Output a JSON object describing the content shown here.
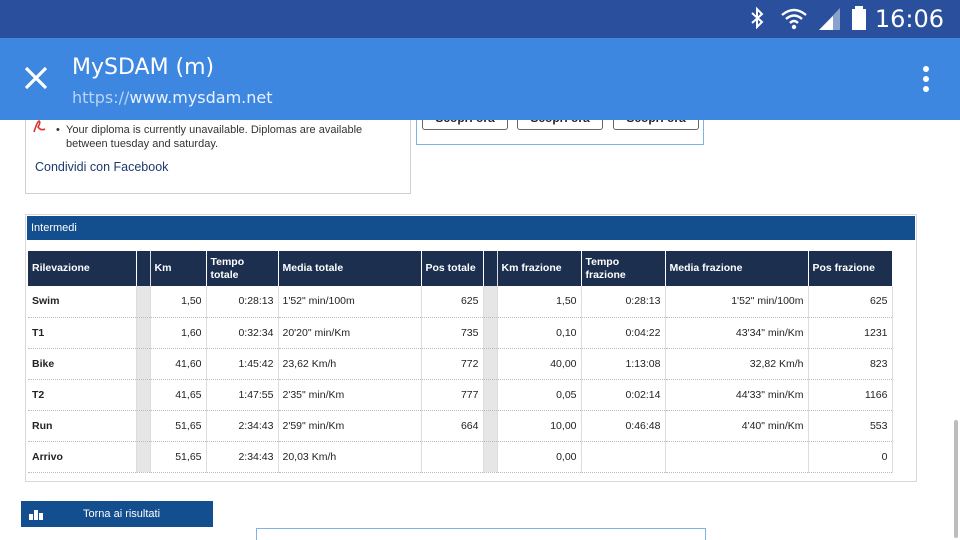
{
  "status_bar": {
    "time": "16:06"
  },
  "app_bar": {
    "title": "MySDAM (m)",
    "url_protocol": "https://",
    "url_host": "www.mysdam.net"
  },
  "diploma": {
    "message": "Your diploma is currently unavailable. Diplomas are available between tuesday and saturday."
  },
  "share": {
    "facebook_label": "Condividi con Facebook"
  },
  "promo": {
    "buttons": [
      "Scopri ora",
      "Scopri ora",
      "Scopri ora"
    ]
  },
  "intermedi": {
    "title": "Intermedi",
    "headers": {
      "rilevazione": "Rilevazione",
      "km": "Km",
      "tempo_totale": "Tempo totale",
      "media_totale": "Media totale",
      "pos_totale": "Pos totale",
      "km_frazione": "Km frazione",
      "tempo_frazione": "Tempo frazione",
      "media_frazione": "Media frazione",
      "pos_frazione": "Pos frazione"
    },
    "rows": [
      {
        "name": "Swim",
        "km": "1,50",
        "tempo": "0:28:13",
        "media": "1'52\" min/100m",
        "pos": "625",
        "kmf": "1,50",
        "tempof": "0:28:13",
        "mediaf": "1'52\" min/100m",
        "posf": "625"
      },
      {
        "name": "T1",
        "km": "1,60",
        "tempo": "0:32:34",
        "media": "20'20\" min/Km",
        "pos": "735",
        "kmf": "0,10",
        "tempof": "0:04:22",
        "mediaf": "43'34\" min/Km",
        "posf": "1231"
      },
      {
        "name": "Bike",
        "km": "41,60",
        "tempo": "1:45:42",
        "media": "23,62 Km/h",
        "pos": "772",
        "kmf": "40,00",
        "tempof": "1:13:08",
        "mediaf": "32,82 Km/h",
        "posf": "823"
      },
      {
        "name": "T2",
        "km": "41,65",
        "tempo": "1:47:55",
        "media": "2'35\" min/Km",
        "pos": "777",
        "kmf": "0,05",
        "tempof": "0:02:14",
        "mediaf": "44'33\" min/Km",
        "posf": "1166"
      },
      {
        "name": "Run",
        "km": "51,65",
        "tempo": "2:34:43",
        "media": "2'59\" min/Km",
        "pos": "664",
        "kmf": "10,00",
        "tempof": "0:46:48",
        "mediaf": "4'40\" min/Km",
        "posf": "553"
      },
      {
        "name": "Arrivo",
        "km": "51,65",
        "tempo": "2:34:43",
        "media": "20,03 Km/h",
        "pos": "",
        "kmf": "0,00",
        "tempof": "",
        "mediaf": "",
        "posf": "0"
      }
    ]
  },
  "back_button": {
    "label": "Torna ai risultati"
  },
  "colors": {
    "status_bar": "#2a4f9c",
    "app_bar": "#3d87e0",
    "panel_header": "#134e8e",
    "table_header": "#1c2f4f"
  }
}
